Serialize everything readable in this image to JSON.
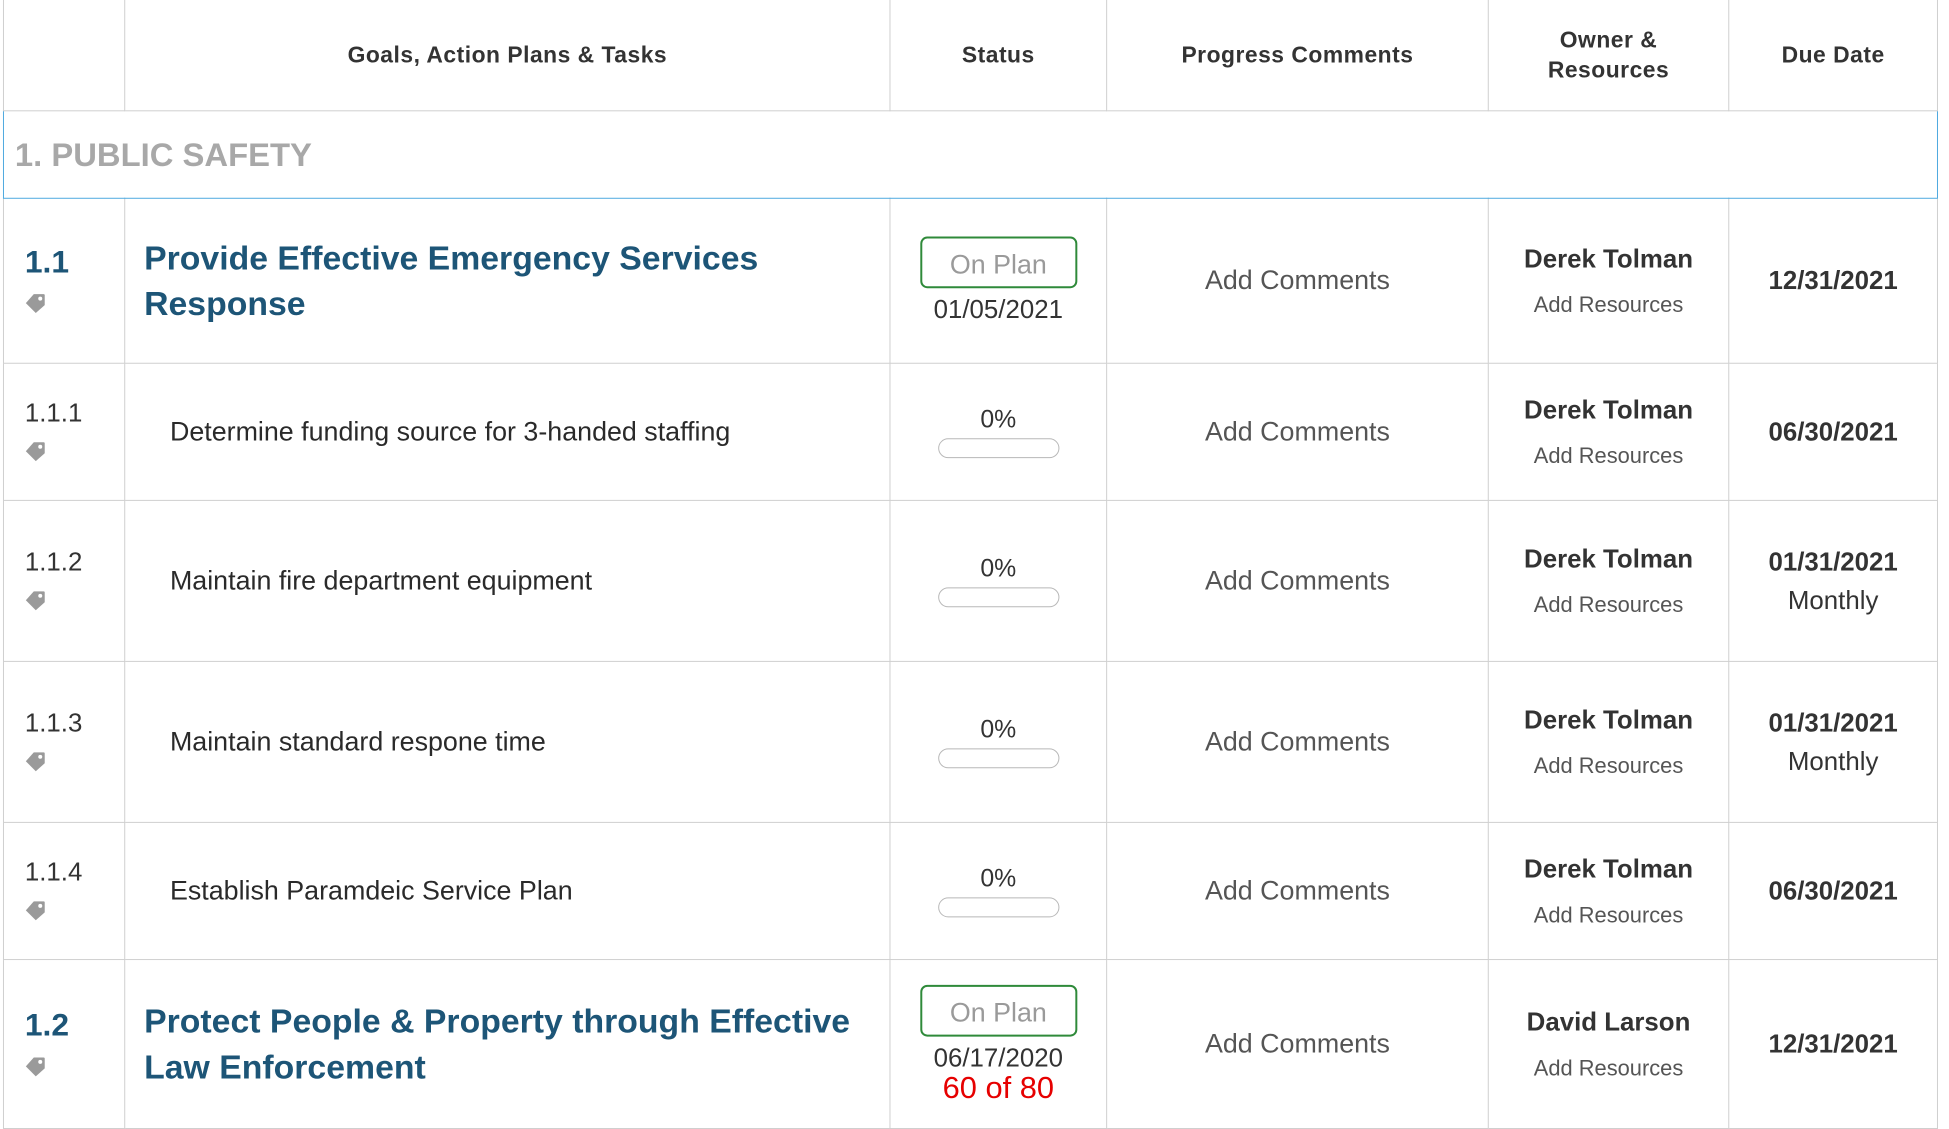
{
  "headers": {
    "number": "",
    "goals": "Goals, Action Plans & Tasks",
    "status": "Status",
    "comments": "Progress Comments",
    "owner_line1": "Owner &",
    "owner_line2": "Resources",
    "due": "Due Date"
  },
  "section": {
    "title": "1. PUBLIC SAFETY"
  },
  "rows": [
    {
      "number": "1.1",
      "title": "Provide Effective Emergency Services Response",
      "status_label": "On Plan",
      "status_date": "01/05/2021",
      "comments": "Add Comments",
      "owner": "Derek Tolman",
      "resources": "Add Resources",
      "due": "12/31/2021"
    },
    {
      "number": "1.1.1",
      "title": "Determine funding source for 3-handed staffing",
      "progress": "0%",
      "progress_value": 0,
      "comments": "Add Comments",
      "owner": "Derek Tolman",
      "resources": "Add Resources",
      "due": "06/30/2021"
    },
    {
      "number": "1.1.2",
      "title": "Maintain fire department equipment",
      "progress": "0%",
      "progress_value": 0,
      "comments": "Add Comments",
      "owner": "Derek Tolman",
      "resources": "Add Resources",
      "due": "01/31/2021",
      "frequency": "Monthly"
    },
    {
      "number": "1.1.3",
      "title": "Maintain standard respone time",
      "progress": "0%",
      "progress_value": 0,
      "comments": "Add Comments",
      "owner": "Derek Tolman",
      "resources": "Add Resources",
      "due": "01/31/2021",
      "frequency": "Monthly"
    },
    {
      "number": "1.1.4",
      "title": "Establish Paramdeic Service Plan",
      "progress": "0%",
      "progress_value": 0,
      "comments": "Add Comments",
      "owner": "Derek Tolman",
      "resources": "Add Resources",
      "due": "06/30/2021"
    },
    {
      "number": "1.2",
      "title": "Protect People & Property through Effective Law Enforcement",
      "status_label": "On Plan",
      "status_date": "06/17/2020",
      "comments": "Add Comments",
      "owner": "David Larson",
      "resources": "Add Resources",
      "due": "12/31/2021"
    }
  ],
  "counter": "60 of 80",
  "colors": {
    "goal_title": "#1d5577",
    "status_border": "#2f8a3a",
    "section_border": "#4ea9e0",
    "counter": "#e60000"
  },
  "icons": {
    "row_tag": "tag-icon"
  }
}
